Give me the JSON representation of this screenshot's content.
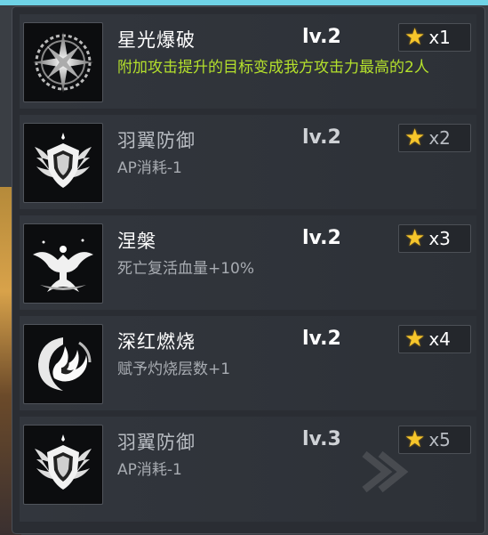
{
  "skills": [
    {
      "name": "星光爆破",
      "level": "lv.2",
      "multiplier": "x1",
      "description": "附加攻击提升的目标变成我方攻击力最高的2人",
      "icon": "starburst-icon",
      "highlight": true
    },
    {
      "name": "羽翼防御",
      "level": "lv.2",
      "multiplier": "x2",
      "description": "AP消耗-1",
      "icon": "winged-shield-icon",
      "highlight": false
    },
    {
      "name": "涅槃",
      "level": "lv.2",
      "multiplier": "x3",
      "description": "死亡复活血量+10%",
      "icon": "phoenix-icon",
      "highlight": false
    },
    {
      "name": "深红燃烧",
      "level": "lv.2",
      "multiplier": "x4",
      "description": "赋予灼烧层数+1",
      "icon": "flame-swirl-icon",
      "highlight": false
    },
    {
      "name": "羽翼防御",
      "level": "lv.3",
      "multiplier": "x5",
      "description": "AP消耗-1",
      "icon": "winged-shield-icon",
      "highlight": false
    }
  ],
  "colors": {
    "highlight_text": "#b4e02c",
    "star": "#f6c62b",
    "panel": "#2a2d33"
  }
}
